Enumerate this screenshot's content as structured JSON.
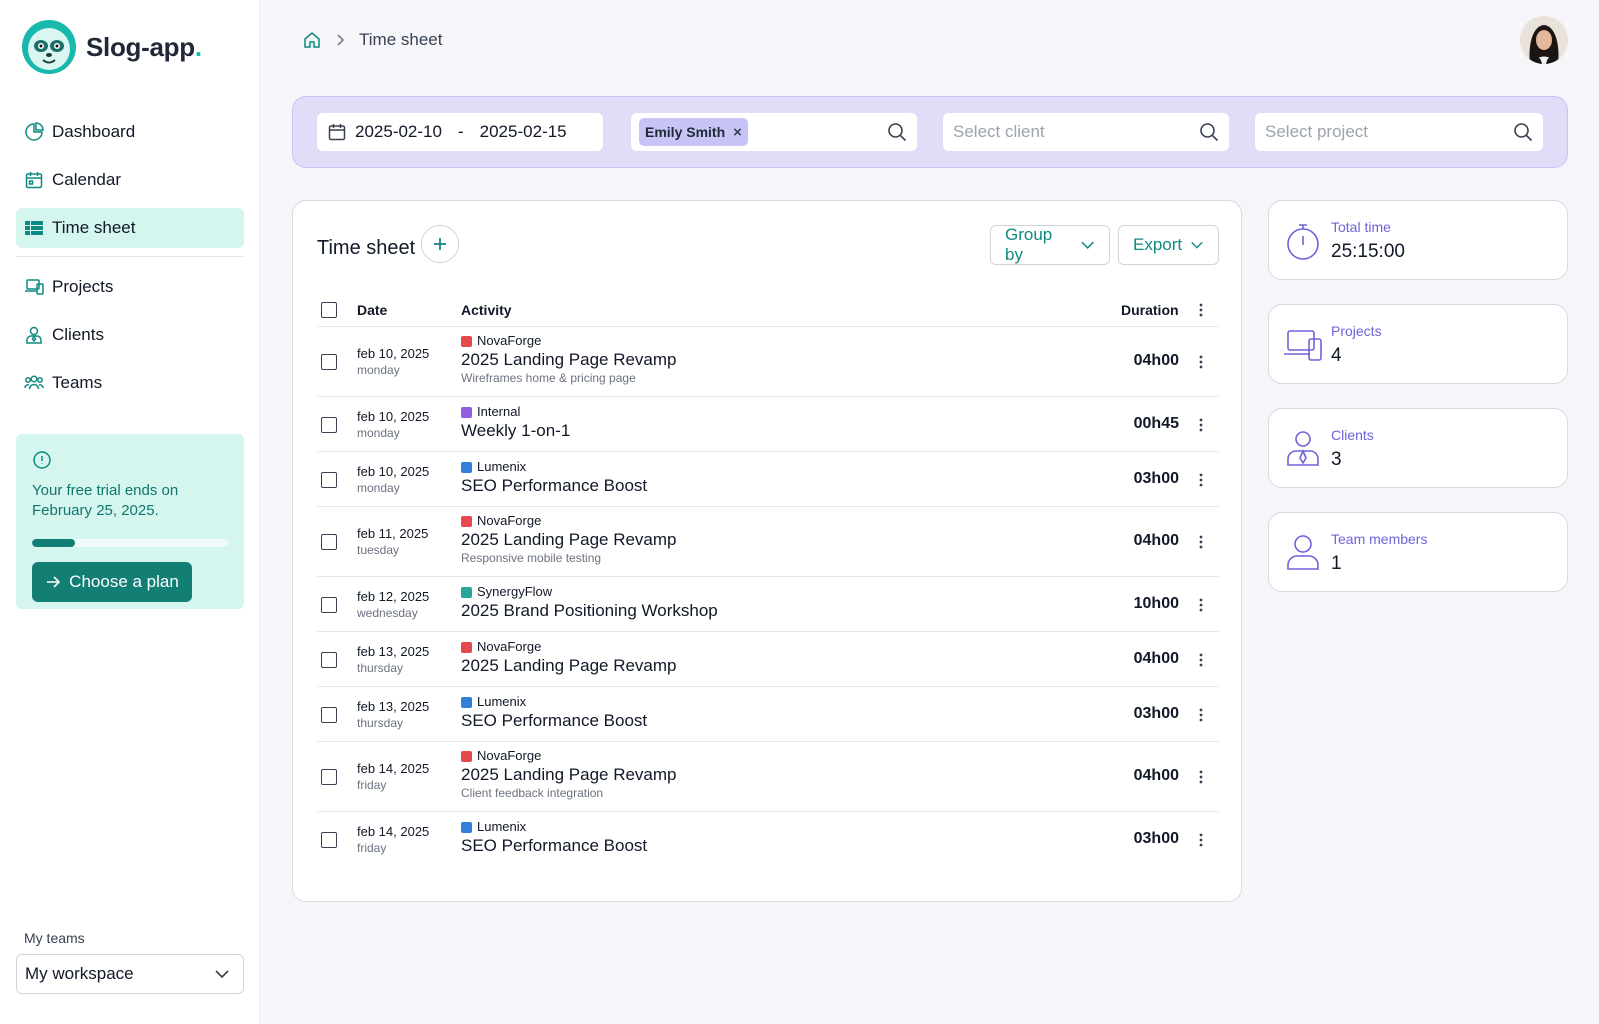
{
  "app": {
    "name": "Slog-app",
    "name_dot": "."
  },
  "sidebar": {
    "nav": [
      {
        "label": "Dashboard",
        "icon": "chart-pie-icon"
      },
      {
        "label": "Calendar",
        "icon": "calendar-icon"
      },
      {
        "label": "Time sheet",
        "icon": "table-list-icon",
        "active": true
      },
      {
        "label": "Projects",
        "icon": "devices-icon"
      },
      {
        "label": "Clients",
        "icon": "user-tie-icon"
      },
      {
        "label": "Teams",
        "icon": "users-icon"
      }
    ],
    "trial": {
      "text": "Your free trial ends on February 25, 2025.",
      "progress": 0.22,
      "button": "Choose a plan"
    },
    "teams_label": "My teams",
    "workspace": "My workspace"
  },
  "breadcrumb": {
    "current": "Time sheet"
  },
  "filters": {
    "date_from": "2025-02-10",
    "date_sep": "-",
    "date_to": "2025-02-15",
    "user_chip": "Emily Smith",
    "client_placeholder": "Select client",
    "project_placeholder": "Select project"
  },
  "timesheet": {
    "title": "Time sheet",
    "group_by": "Group by",
    "export": "Export",
    "columns": {
      "date": "Date",
      "activity": "Activity",
      "duration": "Duration"
    },
    "rows": [
      {
        "date": "feb 10, 2025",
        "day": "monday",
        "client": "NovaForge",
        "color": "#e5484d",
        "project": "2025 Landing Page Revamp",
        "note": "Wireframes home & pricing page",
        "duration": "04h00"
      },
      {
        "date": "feb 10, 2025",
        "day": "monday",
        "client": "Internal",
        "color": "#8e5fe0",
        "project": "Weekly 1-on-1",
        "note": "",
        "duration": "00h45"
      },
      {
        "date": "feb 10, 2025",
        "day": "monday",
        "client": "Lumenix",
        "color": "#2f80d8",
        "project": "SEO Performance Boost",
        "note": "",
        "duration": "03h00"
      },
      {
        "date": "feb 11, 2025",
        "day": "tuesday",
        "client": "NovaForge",
        "color": "#e5484d",
        "project": "2025 Landing Page Revamp",
        "note": "Responsive mobile testing",
        "duration": "04h00"
      },
      {
        "date": "feb 12, 2025",
        "day": "wednesday",
        "client": "SynergyFlow",
        "color": "#25a89a",
        "project": "2025 Brand Positioning Workshop",
        "note": "",
        "duration": "10h00"
      },
      {
        "date": "feb 13, 2025",
        "day": "thursday",
        "client": "NovaForge",
        "color": "#e5484d",
        "project": "2025 Landing Page Revamp",
        "note": "",
        "duration": "04h00"
      },
      {
        "date": "feb 13, 2025",
        "day": "thursday",
        "client": "Lumenix",
        "color": "#2f80d8",
        "project": "SEO Performance Boost",
        "note": "",
        "duration": "03h00"
      },
      {
        "date": "feb 14, 2025",
        "day": "friday",
        "client": "NovaForge",
        "color": "#e5484d",
        "project": "2025 Landing Page Revamp",
        "note": "Client feedback integration",
        "duration": "04h00"
      },
      {
        "date": "feb 14, 2025",
        "day": "friday",
        "client": "Lumenix",
        "color": "#2f80d8",
        "project": "SEO Performance Boost",
        "note": "",
        "duration": "03h00"
      }
    ]
  },
  "stats": [
    {
      "label": "Total time",
      "value": "25:15:00",
      "icon": "stopwatch-icon"
    },
    {
      "label": "Projects",
      "value": "4",
      "icon": "devices-icon"
    },
    {
      "label": "Clients",
      "value": "3",
      "icon": "user-tie-icon"
    },
    {
      "label": "Team members",
      "value": "1",
      "icon": "user-icon"
    }
  ],
  "colors": {
    "accent": "#0f8a80",
    "accent_light": "#d5f5ef",
    "purple": "#6e63d8",
    "filter_bg": "#e0ddf8"
  }
}
